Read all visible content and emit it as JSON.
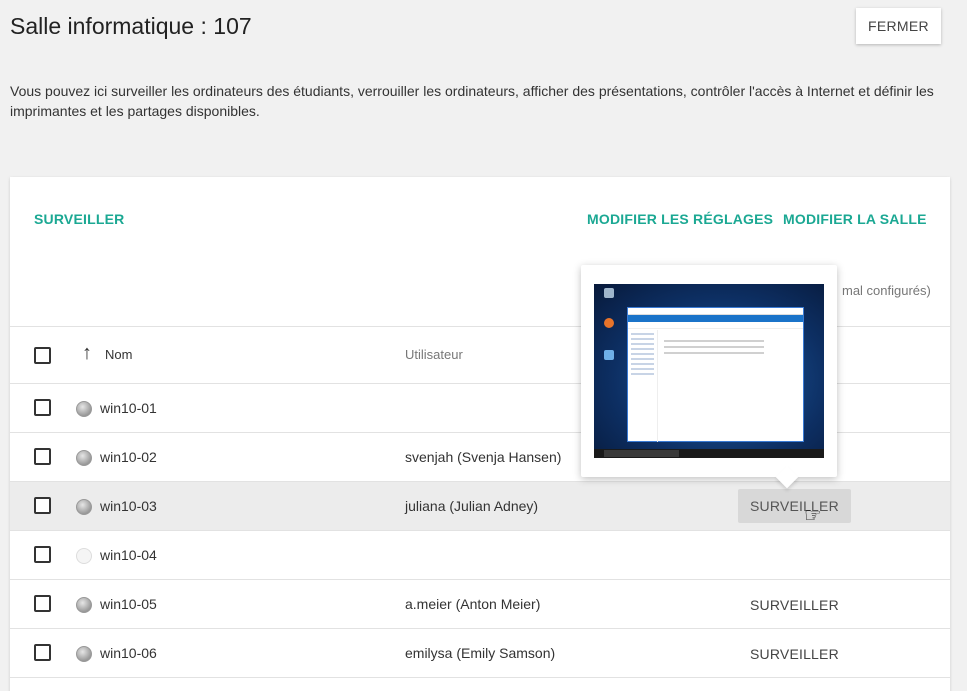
{
  "header": {
    "title": "Salle informatique : 107",
    "close_label": "FERMER"
  },
  "intro_text": "Vous pouvez ici surveiller les ordinateurs des étudiants, verrouiller les ordinateurs, afficher des présentations, contrôler l'accès à Internet et définir les imprimantes et les partages disponibles.",
  "toolbar": {
    "monitor_label": "SURVEILLER",
    "settings_label": "MODIFIER LES RÉGLAGES",
    "room_label": "MODIFIER LA SALLE",
    "misconfig_text": "mal configurés)"
  },
  "table": {
    "columns": {
      "name": "Nom",
      "user": "Utilisateur"
    },
    "rows": [
      {
        "name": "win10-01",
        "user": "",
        "action": "",
        "status": "online"
      },
      {
        "name": "win10-02",
        "user": "svenjah (Svenja Hansen)",
        "action": "",
        "status": "online"
      },
      {
        "name": "win10-03",
        "user": "juliana (Julian Adney)",
        "action": "SURVEILLER",
        "status": "online"
      },
      {
        "name": "win10-04",
        "user": "",
        "action": "",
        "status": "offline"
      },
      {
        "name": "win10-05",
        "user": "a.meier (Anton Meier)",
        "action": "SURVEILLER",
        "status": "online"
      },
      {
        "name": "win10-06",
        "user": "emilysa (Emily Samson)",
        "action": "SURVEILLER",
        "status": "online"
      }
    ]
  },
  "icons": {
    "sort": "arrow-up-icon",
    "cursor": "hand-pointer-icon"
  },
  "colors": {
    "accent": "#1ba893",
    "background": "#f1f1f1"
  }
}
